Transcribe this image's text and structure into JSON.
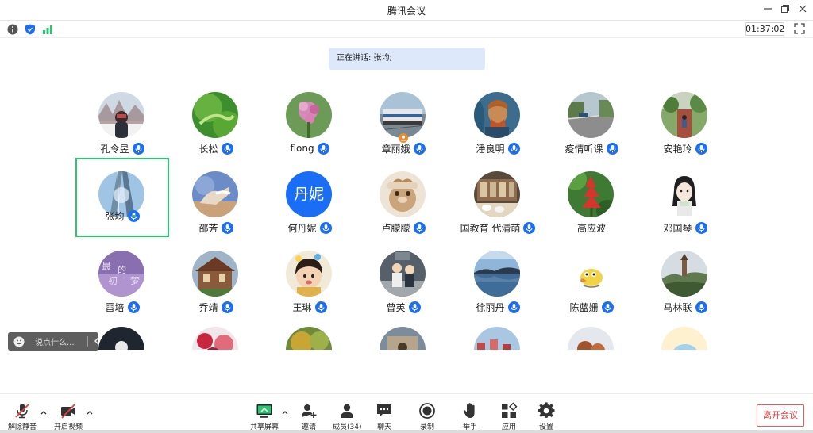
{
  "window": {
    "title": "腾讯会议"
  },
  "infobar": {
    "timer": "01:37:02"
  },
  "speaking": "正在讲话: 张均;",
  "participants": [
    {
      "name": "孔令昱"
    },
    {
      "name": "长松"
    },
    {
      "name": "flong"
    },
    {
      "name": "章丽娥"
    },
    {
      "name": "潘良明"
    },
    {
      "name": "疫情听课"
    },
    {
      "name": "安艳玲"
    },
    {
      "name": "张均"
    },
    {
      "name": "邵芳"
    },
    {
      "name": "何丹妮",
      "avatar_text": "丹妮"
    },
    {
      "name": "卢朦朦"
    },
    {
      "name": "国教育 代清萌"
    },
    {
      "name": "高应波"
    },
    {
      "name": "邓国琴"
    },
    {
      "name": "雷培"
    },
    {
      "name": "乔靖"
    },
    {
      "name": "王琳"
    },
    {
      "name": "曾英"
    },
    {
      "name": "徐丽丹"
    },
    {
      "name": "陈蓝姗"
    },
    {
      "name": "马林联"
    }
  ],
  "chat": {
    "placeholder": "说点什么..."
  },
  "toolbar": {
    "unmute": "解除静音",
    "start_video": "开启视频",
    "share_screen": "共享屏幕",
    "invite": "邀请",
    "members": "成员(34)",
    "chat": "聊天",
    "record": "录制",
    "raise_hand": "举手",
    "apps": "应用",
    "settings": "设置",
    "leave": "离开会议"
  },
  "colors": {
    "accent": "#1a6ef5",
    "active_border": "#2cc56f",
    "leave": "#e04040",
    "speaking_bg": "#dde9fb"
  }
}
